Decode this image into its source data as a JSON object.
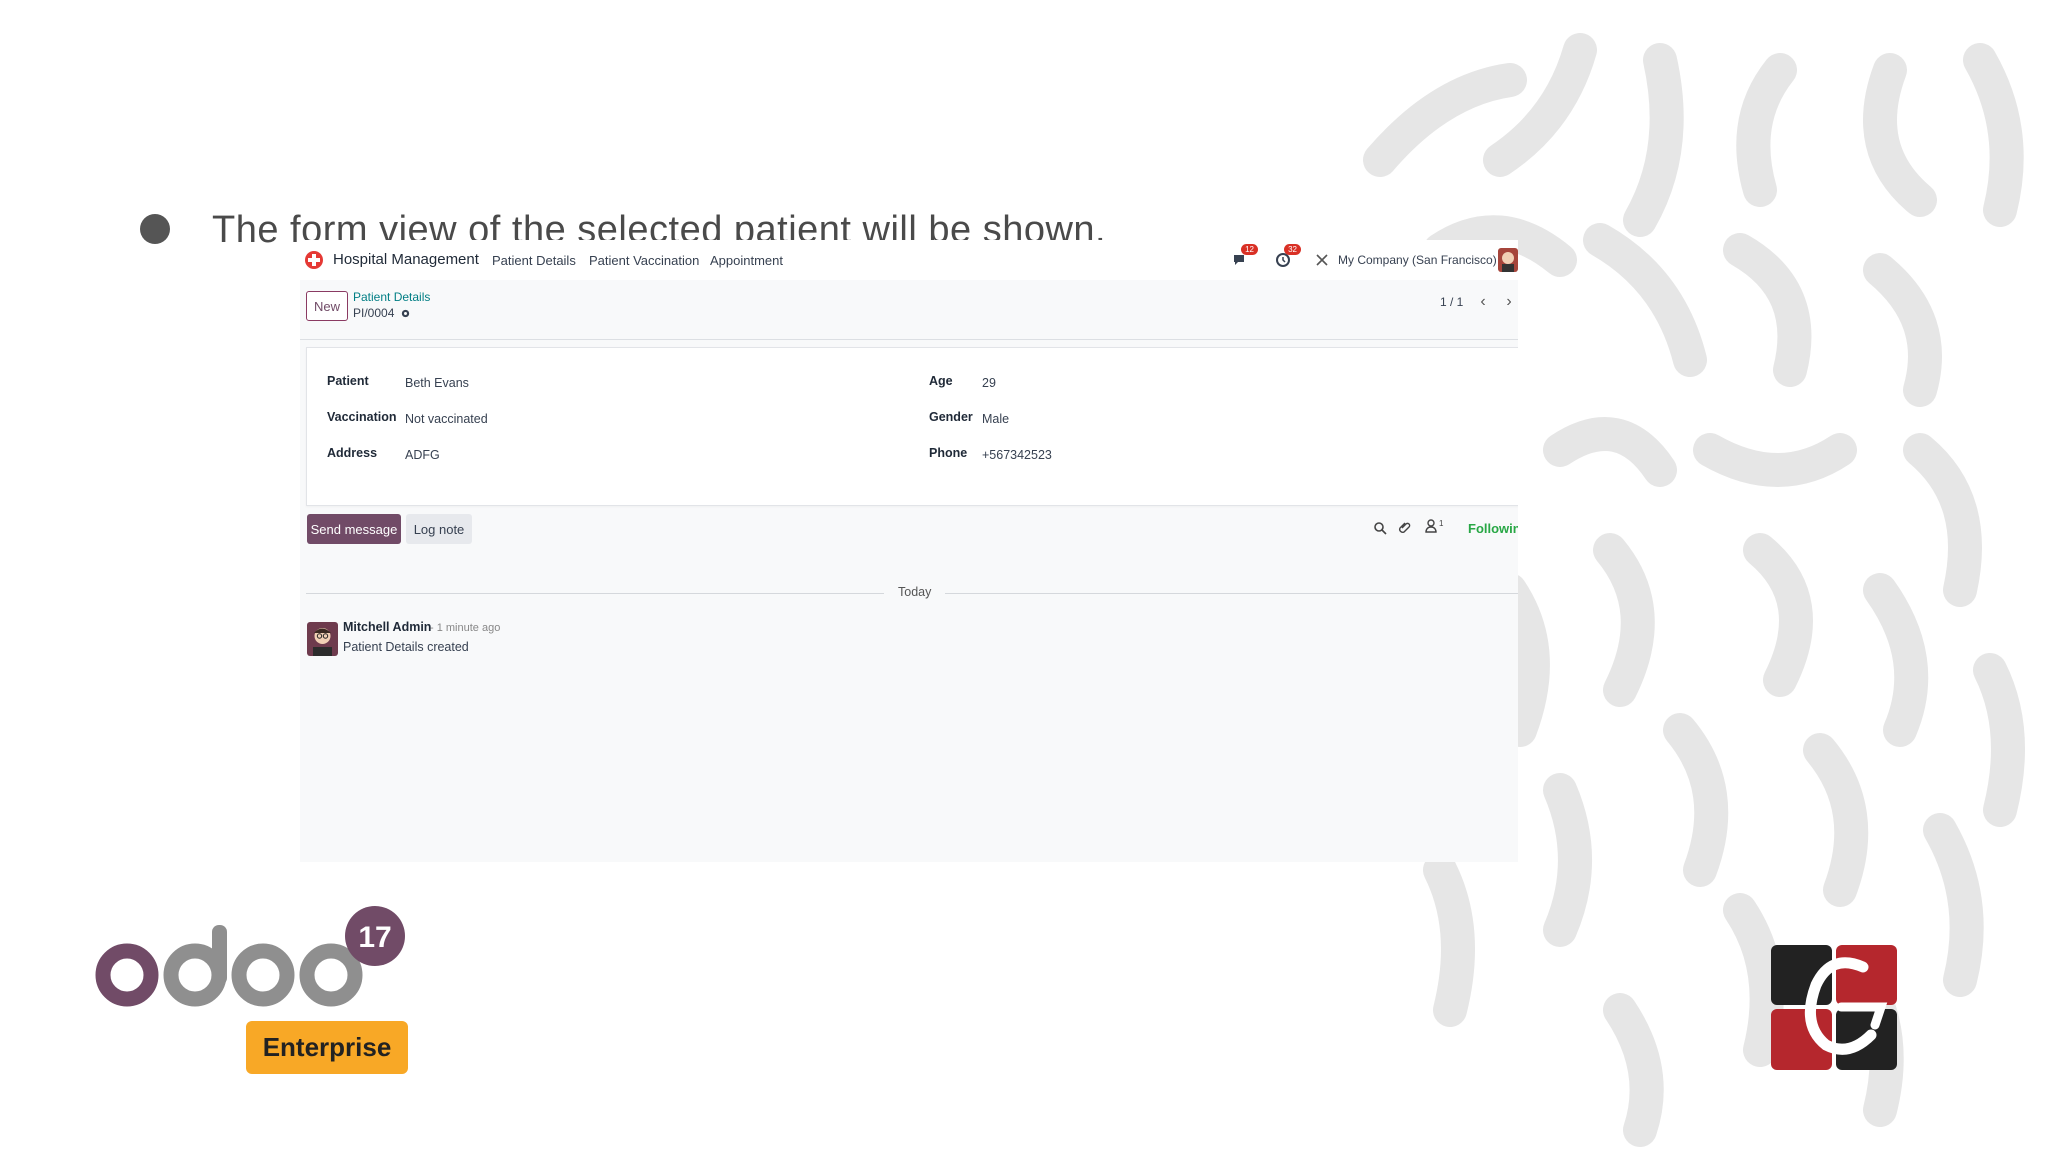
{
  "slide": {
    "bullet_text": "The form view of the selected patient will be shown."
  },
  "navbar": {
    "app_name": "Hospital Management",
    "menu": [
      "Patient Details",
      "Patient Vaccination",
      "Appointment"
    ],
    "messages_badge": "12",
    "activities_badge": "32",
    "company": "My Company (San Francisco)"
  },
  "control_panel": {
    "new_label": "New",
    "breadcrumb_parent": "Patient Details",
    "breadcrumb_current": "PI/0004",
    "pager": "1 / 1"
  },
  "form": {
    "left": [
      {
        "label": "Patient",
        "value": "Beth Evans"
      },
      {
        "label": "Vaccination",
        "value": "Not vaccinated"
      },
      {
        "label": "Address",
        "value": "ADFG"
      }
    ],
    "right": [
      {
        "label": "Age",
        "value": "29"
      },
      {
        "label": "Gender",
        "value": "Male"
      },
      {
        "label": "Phone",
        "value": "+567342523"
      }
    ]
  },
  "chatter": {
    "send_message": "Send message",
    "log_note": "Log note",
    "followers_count": "1",
    "following": "Following",
    "separator": "Today",
    "message": {
      "author": "Mitchell Admin",
      "time": "- 1 minute ago",
      "body": "Patient Details created"
    }
  },
  "branding": {
    "odoo_version": "17",
    "edition": "Enterprise"
  },
  "colors": {
    "primary": "#714b67",
    "badge": "#d93025",
    "link": "#017e84",
    "following": "#28a745",
    "enterprise": "#f8a826"
  }
}
